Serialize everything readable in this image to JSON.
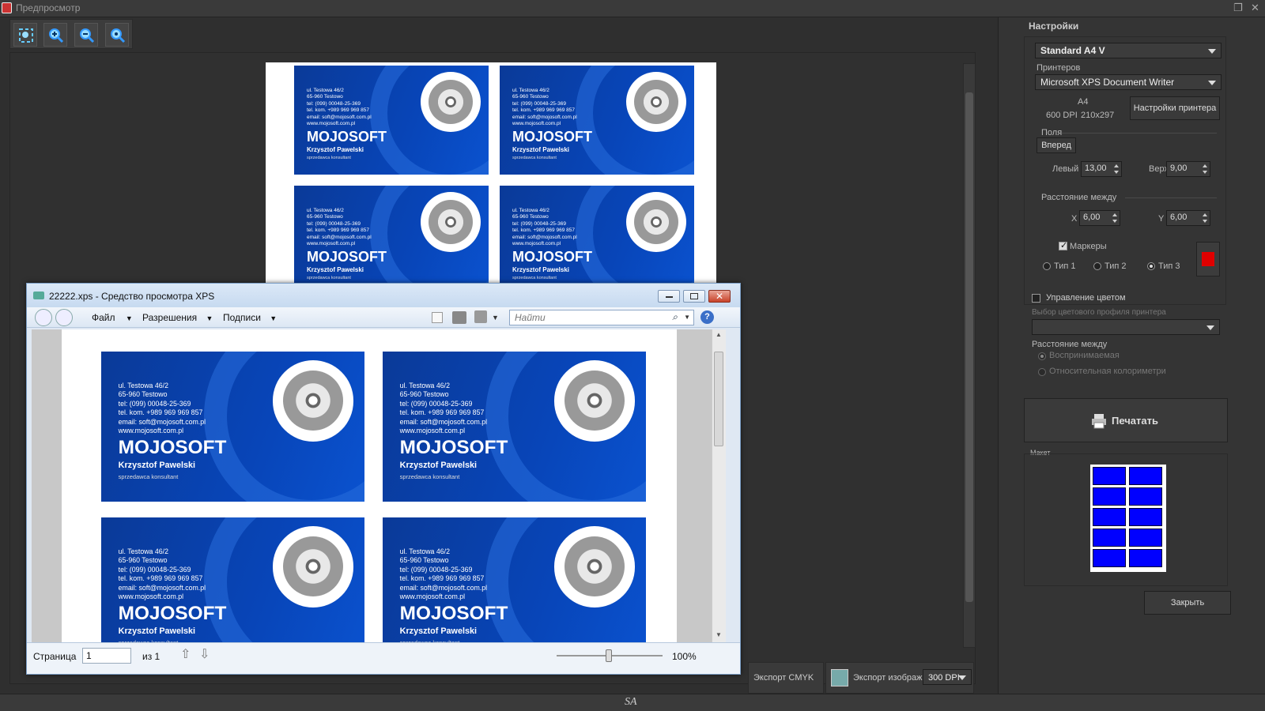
{
  "window": {
    "title": "Предпросмотр"
  },
  "toolbar": {
    "icons": [
      "zoom-fit-icon",
      "zoom-in-icon",
      "zoom-out-icon",
      "zoom-actual-icon"
    ]
  },
  "card": {
    "addr": [
      "ul. Testowa 46/2",
      "65-960 Testowo",
      "tel: (099) 00048-25-369",
      "tel. kom. +989 969 969 857",
      "email: soft@mojosoft.com.pl",
      "www.mojosoft.com.pl"
    ],
    "brand": "MOJOSOFT",
    "person": "Krzysztof Pawelski",
    "role": "sprzedawca konsultant"
  },
  "bottom": {
    "export_cmyk": "Экспорт CMYK",
    "export_image": "Экспорт изображ",
    "dpi": "300 DPI"
  },
  "status": {
    "sa": "SA"
  },
  "settings": {
    "header": "Настройки",
    "preset": "Standard A4 V",
    "printers_label": "Принтеров",
    "printer": "Microsoft XPS Document Writer",
    "paper": "A4",
    "dpi": "600 DPI",
    "size": "210x297",
    "printer_settings": "Настройки принтера",
    "margins_label": "Поля",
    "forward": "Вперед",
    "left_label": "Левый",
    "left_value": "13,00",
    "top_label": "Верх",
    "top_value": "9,00",
    "spacing_label": "Расстояние между",
    "x_label": "X",
    "x_value": "6,00",
    "y_label": "Y",
    "y_value": "6,00",
    "markers_label": "Маркеры",
    "type1": "Тип 1",
    "type2": "Тип 2",
    "type3": "Тип 3",
    "marker_color": "#e00000",
    "color_mgmt": "Управление цветом",
    "color_profile_placeholder": "Выбор цветового профиля принтера",
    "rendering_label": "Расстояние между",
    "perceptual": "Воспринимаемая",
    "relative": "Относительная колориметри",
    "print": "Печатать",
    "layout_label": "Макет",
    "close": "Закрыть"
  },
  "xps": {
    "title": "22222.xps - Средство просмотра XPS",
    "menu_file": "Файл",
    "menu_permissions": "Разрешения",
    "menu_signatures": "Подписи",
    "search_placeholder": "Найти",
    "page_label": "Страница",
    "page_value": "1",
    "of": "из 1",
    "zoom": "100%"
  },
  "colors": {
    "card_blue": "#0845b8",
    "layout_blue": "#0000ff"
  }
}
